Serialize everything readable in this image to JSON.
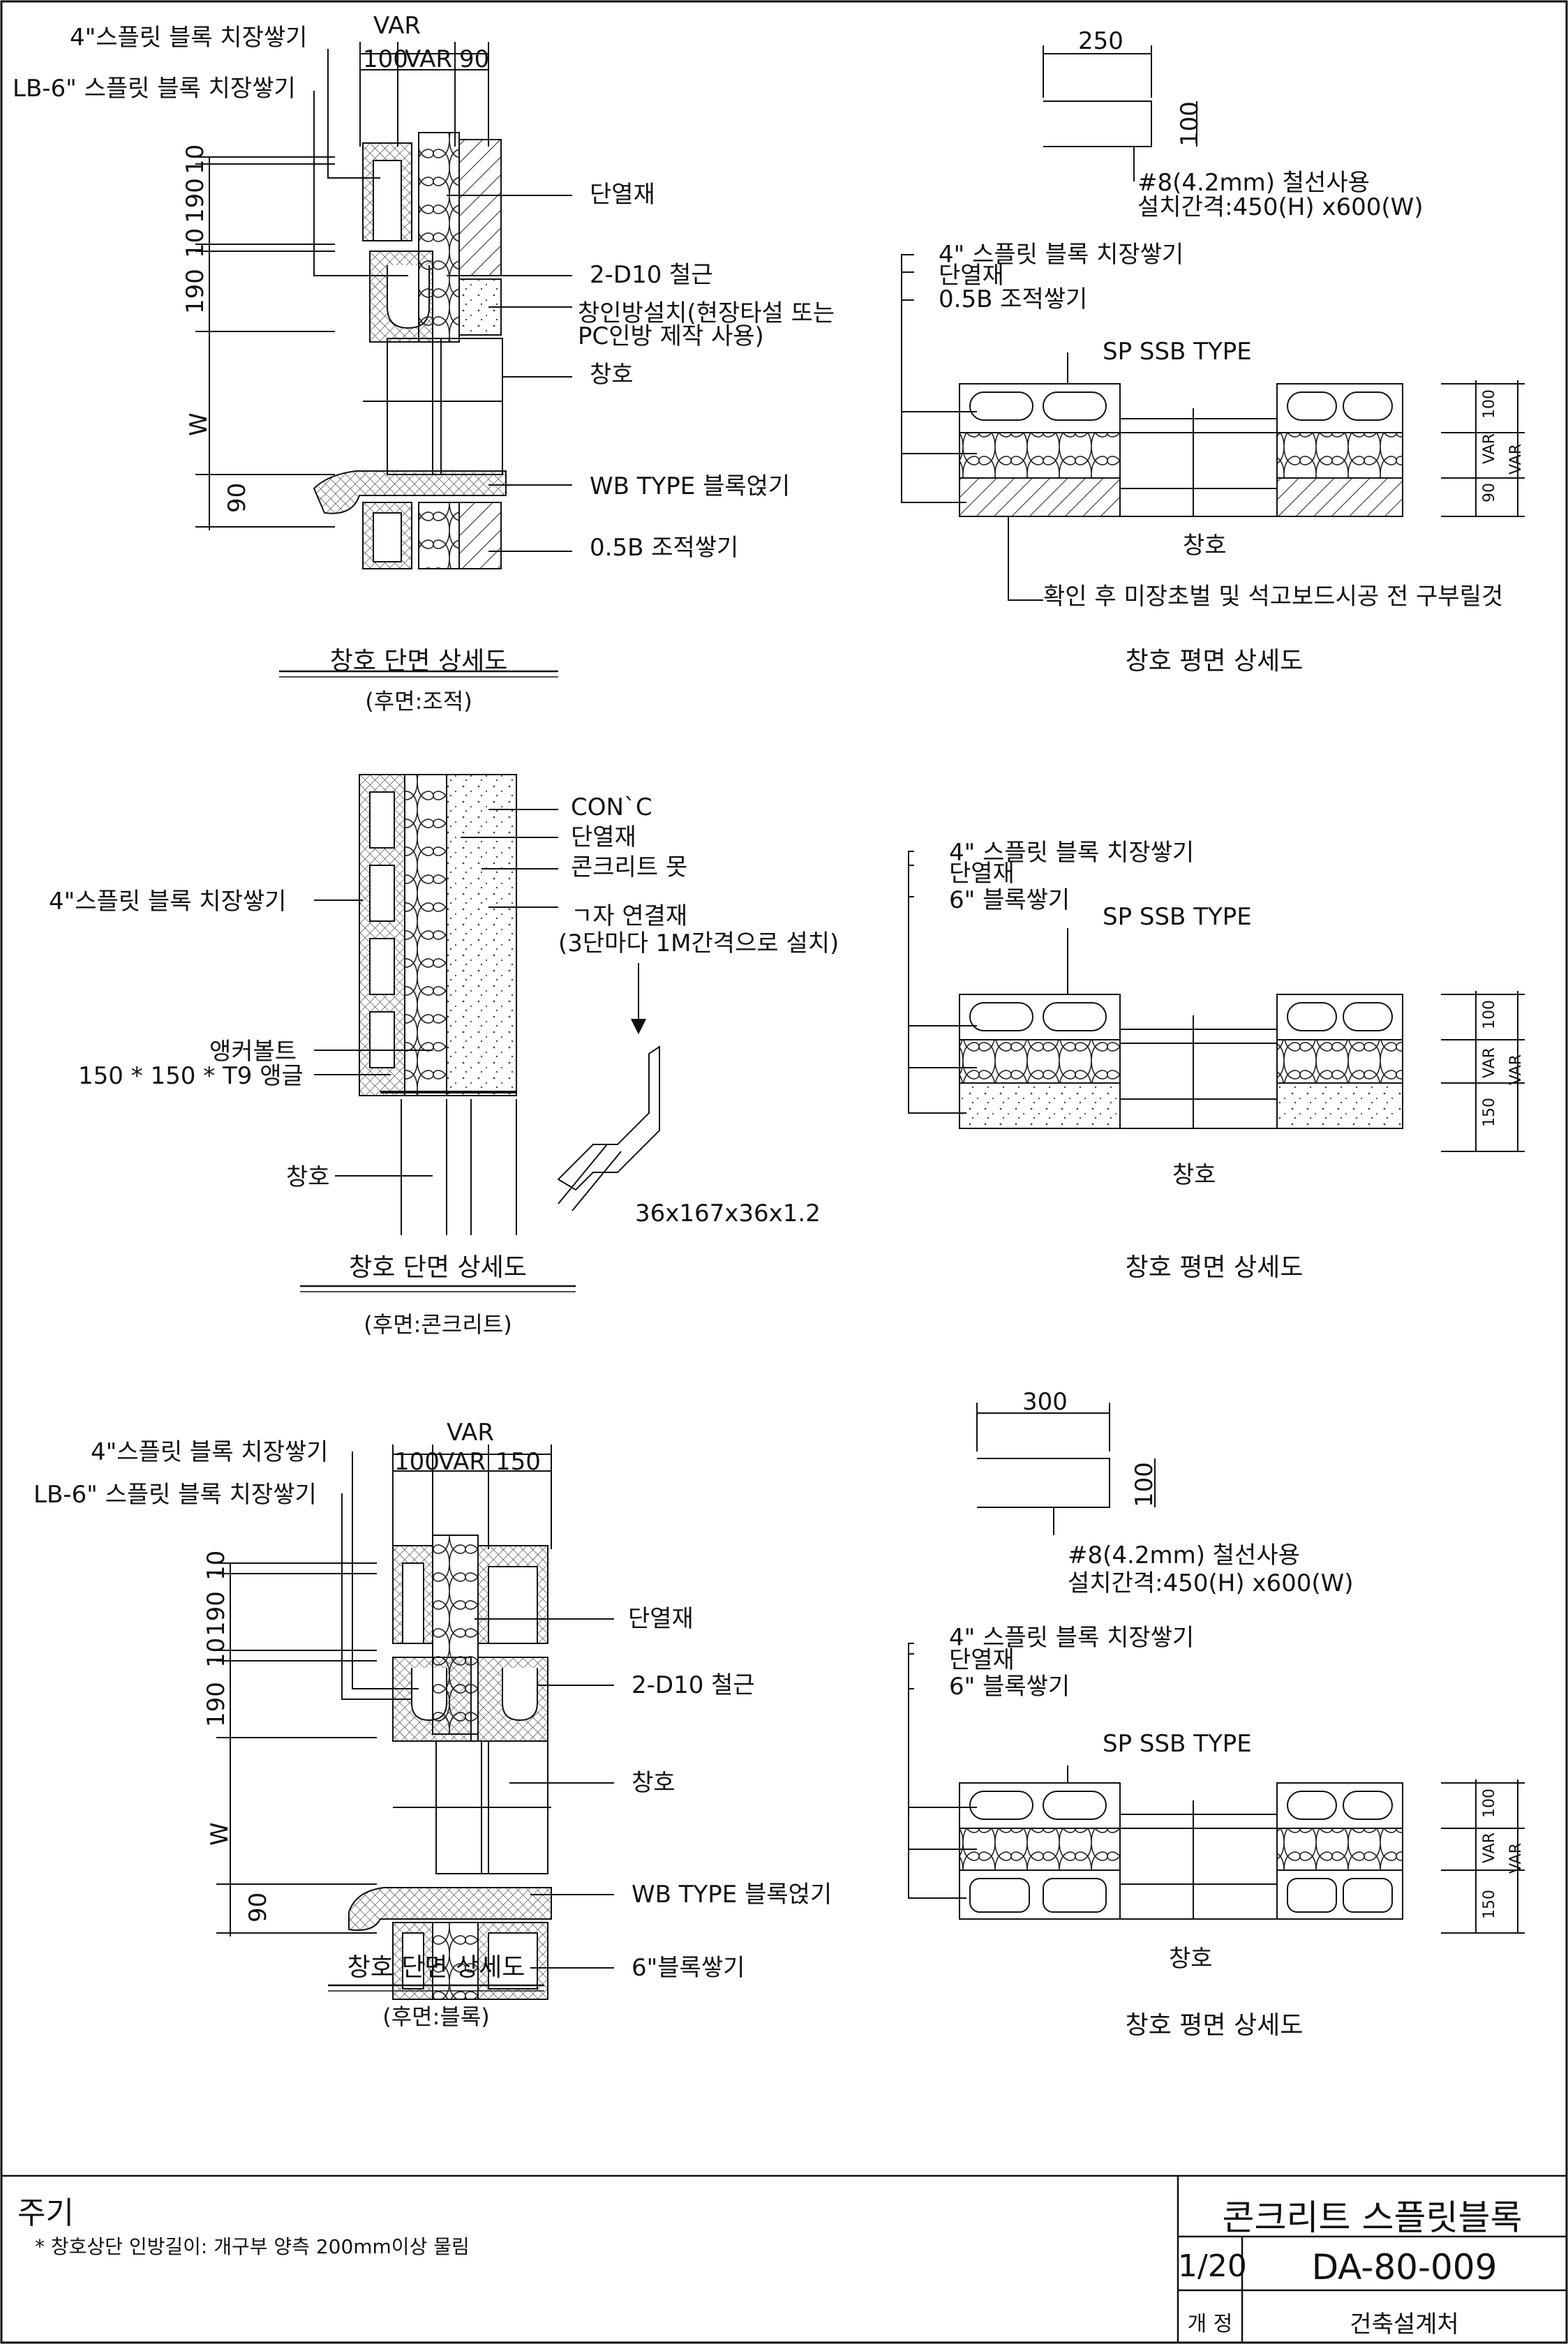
{
  "sections": {
    "s1_section": {
      "dim_var": "VAR",
      "dim_100": "100",
      "dim_var2": "VAR",
      "dim_90": "90",
      "lbl_split": "4\"스플릿 블록 치장쌓기",
      "lbl_lb6": "LB-6\" 스플릿 블록 치장쌓기",
      "v_dims": [
        "10",
        "190",
        "10",
        "190",
        "W",
        "90"
      ],
      "insul": "단열재",
      "rebar": "2-D10 철근",
      "lintel_1": "창인방설치(현장타설 또는",
      "lintel_2": "PC인방 제작 사용)",
      "window": "창호",
      "wb": "WB TYPE 블록얹기",
      "brick": "0.5B 조적쌓기",
      "title": "창호 단면 상세도",
      "subtitle": "(후면:조적)"
    },
    "s1_plan": {
      "dim_250": "250",
      "dim_100": "100",
      "wire_1": "#8(4.2mm) 철선사용",
      "wire_2": "설치간격:450(H) x600(W)",
      "lbl_1": "4\" 스플릿 블록 치장쌓기",
      "lbl_2": "단열재",
      "lbl_3": "0.5B 조적쌓기",
      "sp": "SP SSB TYPE",
      "window": "창호",
      "note": "확인 후 미장초벌 및 석고보드시공 전 구부릴것",
      "dims_r": [
        "100",
        "VAR",
        "90",
        "VAR"
      ],
      "title": "창호 평면 상세도"
    },
    "s2_section": {
      "conc": "CON`C",
      "insul": "단열재",
      "nail": "콘크리트 못",
      "tie_1": "ㄱ자 연결재",
      "tie_2": "(3단마다 1M간격으로 설치)",
      "lbl_split": "4\"스플릿 블록 치장쌓기",
      "anchor": "앵커볼트",
      "angle": "150 * 150 * T9 앵글",
      "window": "창호",
      "bracket": "36x167x36x1.2",
      "title": "창호 단면 상세도",
      "subtitle": "(후면:콘크리트)"
    },
    "s2_plan": {
      "lbl_1": "4\" 스플릿 블록 치장쌓기",
      "lbl_2": "단열재",
      "lbl_3": "6\" 블록쌓기",
      "sp": "SP SSB TYPE",
      "window": "창호",
      "dims_r": [
        "100",
        "VAR",
        "150",
        "VAR"
      ],
      "title": "창호 평면 상세도"
    },
    "s3_section": {
      "dim_var": "VAR",
      "dim_100": "100",
      "dim_var2": "VAR",
      "dim_150": "150",
      "lbl_split": "4\"스플릿 블록 치장쌓기",
      "lbl_lb6": "LB-6\" 스플릿 블록 치장쌓기",
      "v_dims": [
        "10",
        "190",
        "10",
        "190",
        "W",
        "90"
      ],
      "insul": "단열재",
      "rebar": "2-D10 철근",
      "window": "창호",
      "wb": "WB TYPE 블록얹기",
      "block": "6\"블록쌓기",
      "title": "창호 단면 상세도",
      "subtitle": "(후면:블록)"
    },
    "s3_plan": {
      "dim_300": "300",
      "dim_100": "100",
      "wire_1": "#8(4.2mm) 철선사용",
      "wire_2": "설치간격:450(H) x600(W)",
      "lbl_1": "4\" 스플릿 블록 치장쌓기",
      "lbl_2": "단열재",
      "lbl_3": "6\" 블록쌓기",
      "sp": "SP SSB TYPE",
      "window": "창호",
      "dims_r": [
        "100",
        "VAR",
        "150",
        "VAR"
      ],
      "title": "창호 평면 상세도"
    }
  },
  "notes": {
    "heading": "주기",
    "line": "* 창호상단 인방길이: 개구부 양측 200mm이상 물림"
  },
  "title_block": {
    "title": "콘크리트 스플릿블록",
    "scale": "1/20",
    "drawing_no": "DA-80-009",
    "rev_label": "개  정",
    "org": "건축설계처"
  }
}
